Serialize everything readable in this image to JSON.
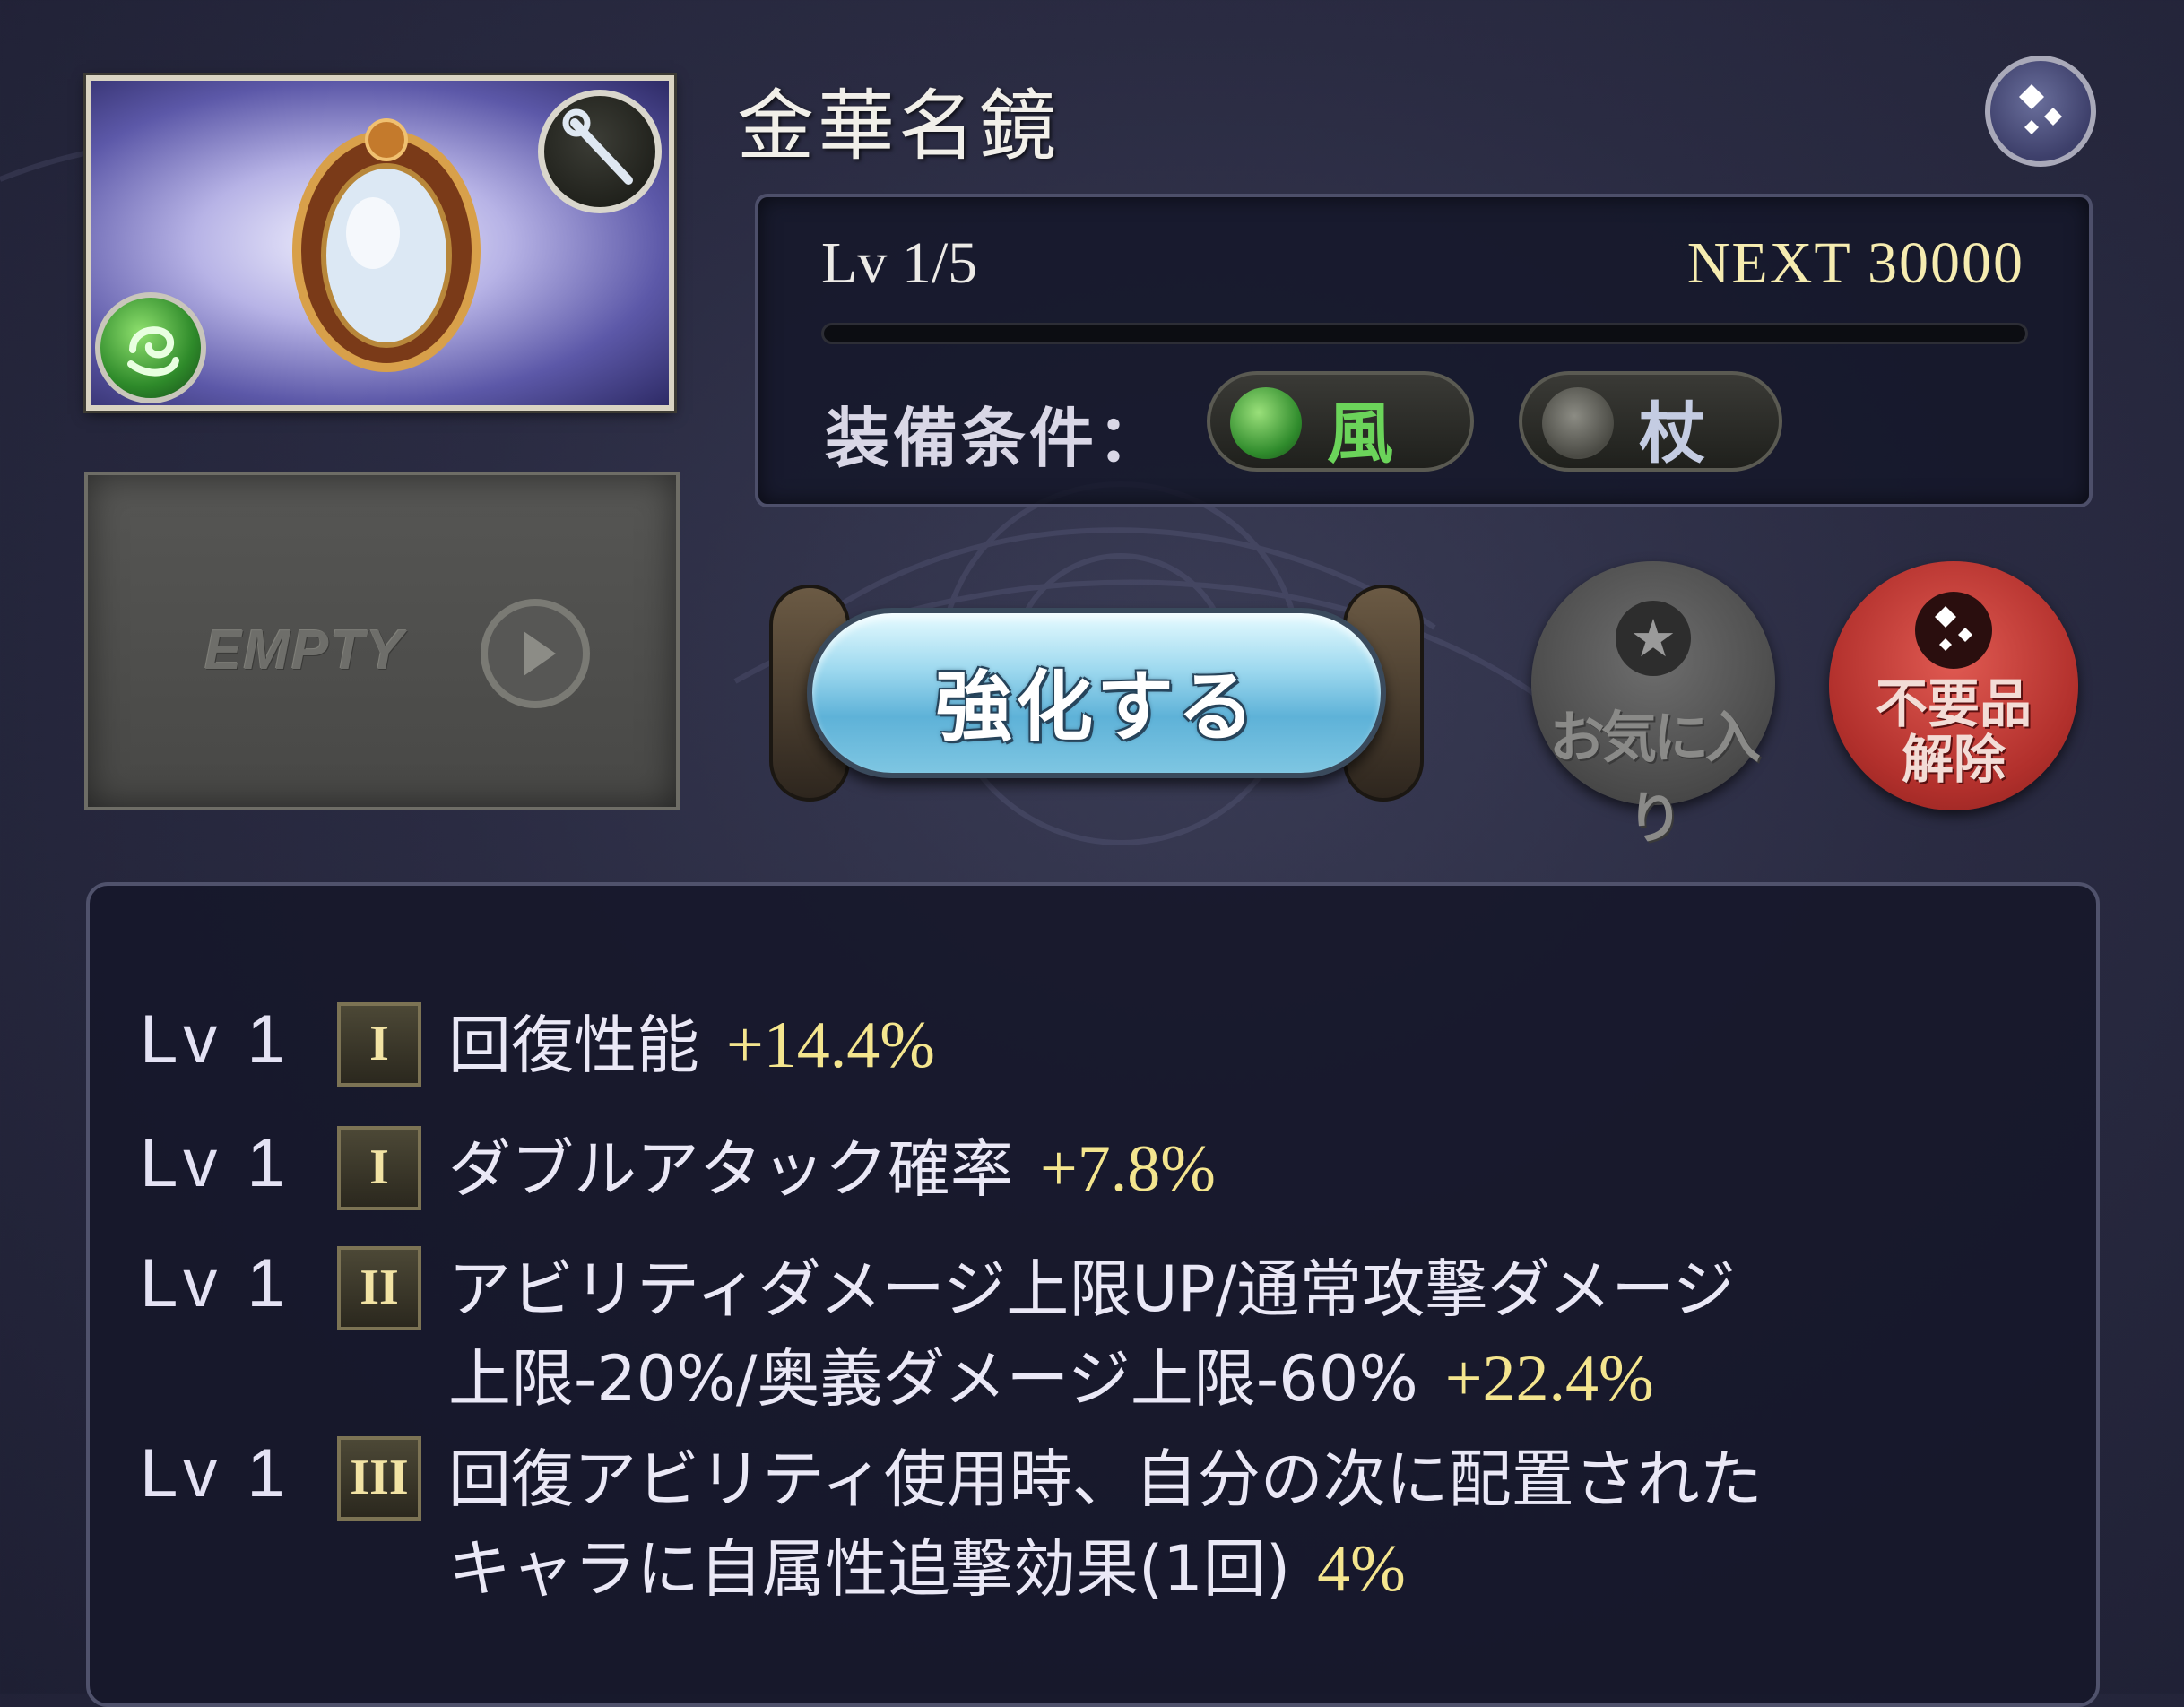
{
  "item": {
    "name": "金華名鏡",
    "element_icon": "wind-element-icon",
    "weapon_type_icon": "staff-icon"
  },
  "empty_slot": {
    "label": "EMPTY"
  },
  "level": {
    "lv_text": "Lv 1/5",
    "next_text": "NEXT 30000",
    "progress": 0
  },
  "equip_conditions": {
    "label": "装備条件：",
    "element": "風",
    "weapon": "杖"
  },
  "buttons": {
    "upgrade": "強化する",
    "favorite": "お気に入り",
    "discard_line1": "不要品",
    "discard_line2": "解除"
  },
  "skills": [
    {
      "lv": "Lv 1",
      "tier": "I",
      "line1": "回復性能",
      "value": "+14.4%"
    },
    {
      "lv": "Lv 1",
      "tier": "I",
      "line1": "ダブルアタック確率",
      "value": "+7.8%"
    },
    {
      "lv": "Lv 1",
      "tier": "II",
      "line1": "アビリティダメージ上限UP/通常攻撃ダメージ",
      "line2": "上限-20%/奥義ダメージ上限-60%",
      "value": "+22.4%"
    },
    {
      "lv": "Lv 1",
      "tier": "III",
      "line1": "回復アビリティ使用時、自分の次に配置された",
      "line2": "キャラに自属性追撃効果(1回)",
      "value": "4%"
    }
  ],
  "colors": {
    "value_gold": "#f4e58e",
    "next_gold": "#f6ecb0",
    "wind_green": "#6bd45a",
    "discard_red": "#b2302c"
  }
}
